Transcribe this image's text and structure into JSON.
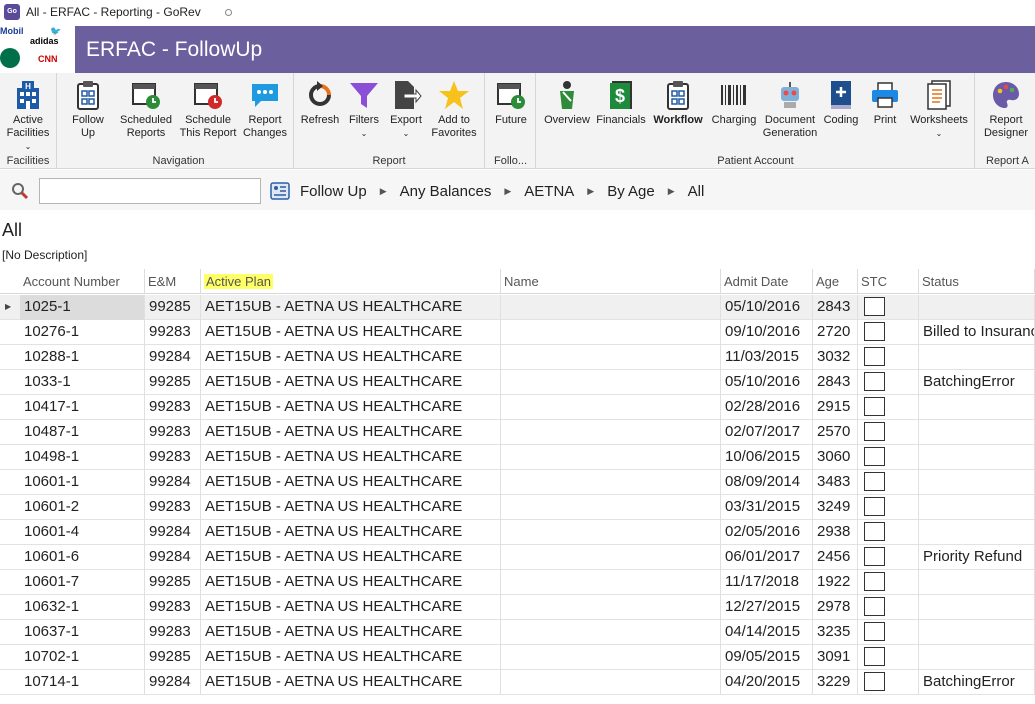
{
  "window": {
    "title": "All - ERFAC - Reporting - GoRev",
    "app_badge": "Go"
  },
  "logos": {
    "mobil": "Mobil",
    "adidas": "adidas",
    "cnn": "CNN"
  },
  "banner": {
    "title": "ERFAC - FollowUp",
    "color": "#6b5f9e"
  },
  "ribbon": {
    "groups": [
      {
        "label": "Facilities",
        "buttons": [
          {
            "label1": "Active",
            "label2": "Facilities",
            "dropdown": true,
            "icon": "building-icon"
          }
        ]
      },
      {
        "label": "Navigation",
        "buttons": [
          {
            "label1": "Follow",
            "label2": "Up",
            "icon": "clipboard-icon"
          },
          {
            "label1": "Scheduled",
            "label2": "Reports",
            "icon": "calendar-clock-icon"
          },
          {
            "label1": "Schedule",
            "label2": "This Report",
            "icon": "calendar-red-icon"
          },
          {
            "label1": "Report",
            "label2": "Changes",
            "icon": "chat-bubble-icon"
          }
        ]
      },
      {
        "label": "Report",
        "buttons": [
          {
            "label1": "Refresh",
            "label2": "",
            "icon": "refresh-icon"
          },
          {
            "label1": "Filters",
            "label2": "",
            "dropdown": true,
            "icon": "funnel-icon"
          },
          {
            "label1": "Export",
            "label2": "",
            "dropdown": true,
            "icon": "export-icon"
          },
          {
            "label1": "Add to",
            "label2": "Favorites",
            "icon": "star-icon"
          }
        ]
      },
      {
        "label": "Follo...",
        "buttons": [
          {
            "label1": "Future",
            "label2": "",
            "icon": "calendar-future-icon"
          }
        ]
      },
      {
        "label": "Patient Account",
        "buttons": [
          {
            "label1": "Overview",
            "label2": "",
            "icon": "patient-icon"
          },
          {
            "label1": "Financials",
            "label2": "",
            "icon": "dollar-doc-icon"
          },
          {
            "label1": "Workflow",
            "label2": "",
            "bold": true,
            "icon": "workflow-icon"
          },
          {
            "label1": "Charging",
            "label2": "",
            "icon": "barcode-icon"
          },
          {
            "label1": "Document",
            "label2": "Generation",
            "icon": "robot-icon"
          },
          {
            "label1": "Coding",
            "label2": "",
            "icon": "book-icon"
          },
          {
            "label1": "Print",
            "label2": "",
            "icon": "printer-icon"
          },
          {
            "label1": "Worksheets",
            "label2": "",
            "dropdown": true,
            "icon": "worksheet-icon"
          }
        ]
      },
      {
        "label": "Report A",
        "buttons": [
          {
            "label1": "Report",
            "label2": "Designer",
            "icon": "palette-icon"
          }
        ]
      }
    ]
  },
  "search": {
    "value": "",
    "placeholder": ""
  },
  "breadcrumb": [
    "Follow Up",
    "Any Balances",
    "AETNA",
    "By Age",
    "All"
  ],
  "view": {
    "title": "All",
    "description": "[No Description]"
  },
  "grid": {
    "columns": [
      "Account Number",
      "E&M",
      "Active Plan",
      "Name",
      "Admit Date",
      "Age",
      "STC",
      "Status"
    ],
    "rows": [
      [
        "1025-1",
        "99285",
        "AET15UB - AETNA US HEALTHCARE",
        "",
        "05/10/2016",
        "2843",
        "",
        ""
      ],
      [
        "10276-1",
        "99283",
        "AET15UB - AETNA US HEALTHCARE",
        "",
        "09/10/2016",
        "2720",
        "",
        "Billed to Insurance"
      ],
      [
        "10288-1",
        "99284",
        "AET15UB - AETNA US HEALTHCARE",
        "",
        "11/03/2015",
        "3032",
        "",
        ""
      ],
      [
        "1033-1",
        "99285",
        "AET15UB - AETNA US HEALTHCARE",
        "",
        "05/10/2016",
        "2843",
        "",
        "BatchingError"
      ],
      [
        "10417-1",
        "99283",
        "AET15UB - AETNA US HEALTHCARE",
        "",
        "02/28/2016",
        "2915",
        "",
        ""
      ],
      [
        "10487-1",
        "99283",
        "AET15UB - AETNA US HEALTHCARE",
        "",
        "02/07/2017",
        "2570",
        "",
        ""
      ],
      [
        "10498-1",
        "99283",
        "AET15UB - AETNA US HEALTHCARE",
        "",
        "10/06/2015",
        "3060",
        "",
        ""
      ],
      [
        "10601-1",
        "99284",
        "AET15UB - AETNA US HEALTHCARE",
        "",
        "08/09/2014",
        "3483",
        "",
        ""
      ],
      [
        "10601-2",
        "99283",
        "AET15UB - AETNA US HEALTHCARE",
        "",
        "03/31/2015",
        "3249",
        "",
        ""
      ],
      [
        "10601-4",
        "99284",
        "AET15UB - AETNA US HEALTHCARE",
        "",
        "02/05/2016",
        "2938",
        "",
        ""
      ],
      [
        "10601-6",
        "99284",
        "AET15UB - AETNA US HEALTHCARE",
        "",
        "06/01/2017",
        "2456",
        "",
        "Priority Refund"
      ],
      [
        "10601-7",
        "99285",
        "AET15UB - AETNA US HEALTHCARE",
        "",
        "11/17/2018",
        "1922",
        "",
        ""
      ],
      [
        "10632-1",
        "99283",
        "AET15UB - AETNA US HEALTHCARE",
        "",
        "12/27/2015",
        "2978",
        "",
        ""
      ],
      [
        "10637-1",
        "99283",
        "AET15UB - AETNA US HEALTHCARE",
        "",
        "04/14/2015",
        "3235",
        "",
        ""
      ],
      [
        "10702-1",
        "99285",
        "AET15UB - AETNA US HEALTHCARE",
        "",
        "09/05/2015",
        "3091",
        "",
        ""
      ],
      [
        "10714-1",
        "99284",
        "AET15UB - AETNA US HEALTHCARE",
        "",
        "04/20/2015",
        "3229",
        "",
        "BatchingError"
      ]
    ],
    "highlight_color": "#ffff66"
  }
}
